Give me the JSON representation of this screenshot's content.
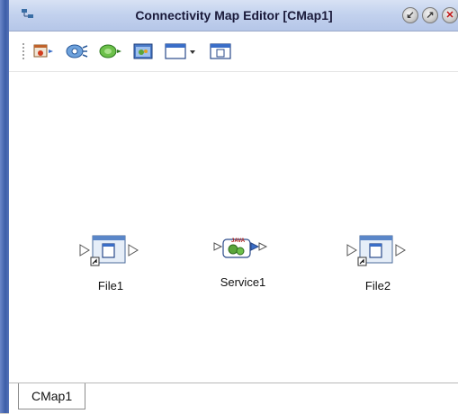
{
  "window": {
    "title": "Connectivity Map Editor [CMap1]"
  },
  "toolbar": {
    "buttons": [
      {
        "name": "add-external-application-button",
        "icon": "external-application-icon"
      },
      {
        "name": "add-web-service-button",
        "icon": "web-service-icon"
      },
      {
        "name": "add-database-button",
        "icon": "database-icon"
      },
      {
        "name": "add-service-button",
        "icon": "service-icon"
      },
      {
        "name": "external-system-dropdown-button",
        "icon": "window-dropdown-icon"
      },
      {
        "name": "add-file-button",
        "icon": "file-app-icon"
      }
    ]
  },
  "canvas": {
    "nodes": [
      {
        "label": "File1",
        "icon": "file-application-icon"
      },
      {
        "label": "Service1",
        "icon": "java-service-icon"
      },
      {
        "label": "File2",
        "icon": "file-application-icon"
      }
    ]
  },
  "tabs": [
    {
      "label": "CMap1"
    }
  ],
  "colors": {
    "titlebar": "#c3d2ee",
    "left_bar": "#3d5ea8",
    "canvas": "#ffffff",
    "close_x": "#c01010"
  }
}
